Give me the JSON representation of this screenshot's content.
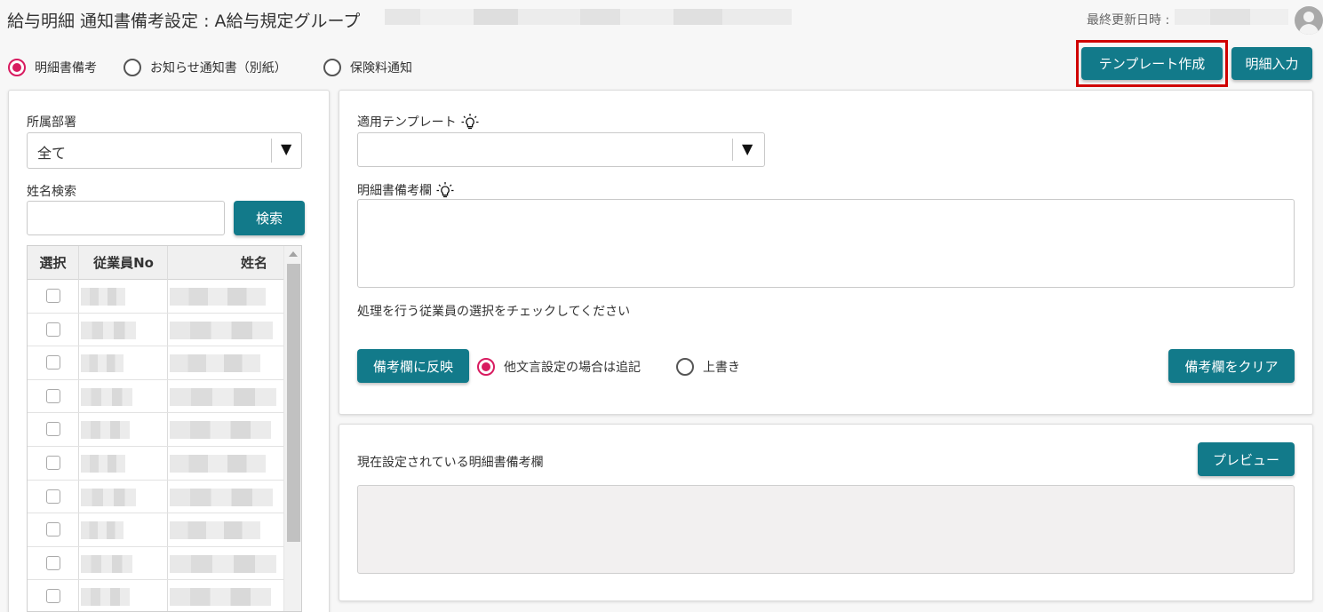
{
  "header": {
    "title": "給与明細 通知書備考設定 : A給与規定グループ",
    "last_updated_label": "最終更新日時 :",
    "last_updated_value": ""
  },
  "mode_radios": [
    {
      "label": "明細書備考",
      "checked": true
    },
    {
      "label": "お知らせ通知書（別紙）",
      "checked": false
    },
    {
      "label": "保険料通知",
      "checked": false
    }
  ],
  "actions": {
    "template_create": "テンプレート作成",
    "detail_input": "明細入力"
  },
  "left": {
    "dept_label": "所属部署",
    "dept_value": "全て",
    "name_search_label": "姓名検索",
    "name_search_value": "",
    "search_button": "検索",
    "table": {
      "columns": [
        "選択",
        "従業員No",
        "姓名"
      ],
      "rows": [
        {
          "selected": false,
          "employee_no": "",
          "name": ""
        },
        {
          "selected": false,
          "employee_no": "",
          "name": ""
        },
        {
          "selected": false,
          "employee_no": "",
          "name": ""
        },
        {
          "selected": false,
          "employee_no": "",
          "name": ""
        },
        {
          "selected": false,
          "employee_no": "",
          "name": ""
        },
        {
          "selected": false,
          "employee_no": "",
          "name": ""
        },
        {
          "selected": false,
          "employee_no": "",
          "name": ""
        },
        {
          "selected": false,
          "employee_no": "",
          "name": ""
        },
        {
          "selected": false,
          "employee_no": "",
          "name": ""
        },
        {
          "selected": false,
          "employee_no": "",
          "name": ""
        }
      ]
    }
  },
  "editor": {
    "template_label": "適用テンプレート",
    "template_value": "",
    "remarks_label": "明細書備考欄",
    "remarks_value": "",
    "instruction": "処理を行う従業員の選択をチェックしてください",
    "apply_button": "備考欄に反映",
    "append_option": "他文言設定の場合は追記",
    "overwrite_option": "上書き",
    "append_checked": true,
    "clear_button": "備考欄をクリア"
  },
  "current": {
    "label": "現在設定されている明細書備考欄",
    "preview_button": "プレビュー",
    "content": ""
  },
  "colors": {
    "accent": "#127a8a",
    "radio_checked": "#d81b60",
    "highlight": "#d00000"
  },
  "icons": {
    "hint": "lightbulb-icon",
    "user": "user-avatar-icon",
    "dropdown": "triangle-down-icon"
  }
}
